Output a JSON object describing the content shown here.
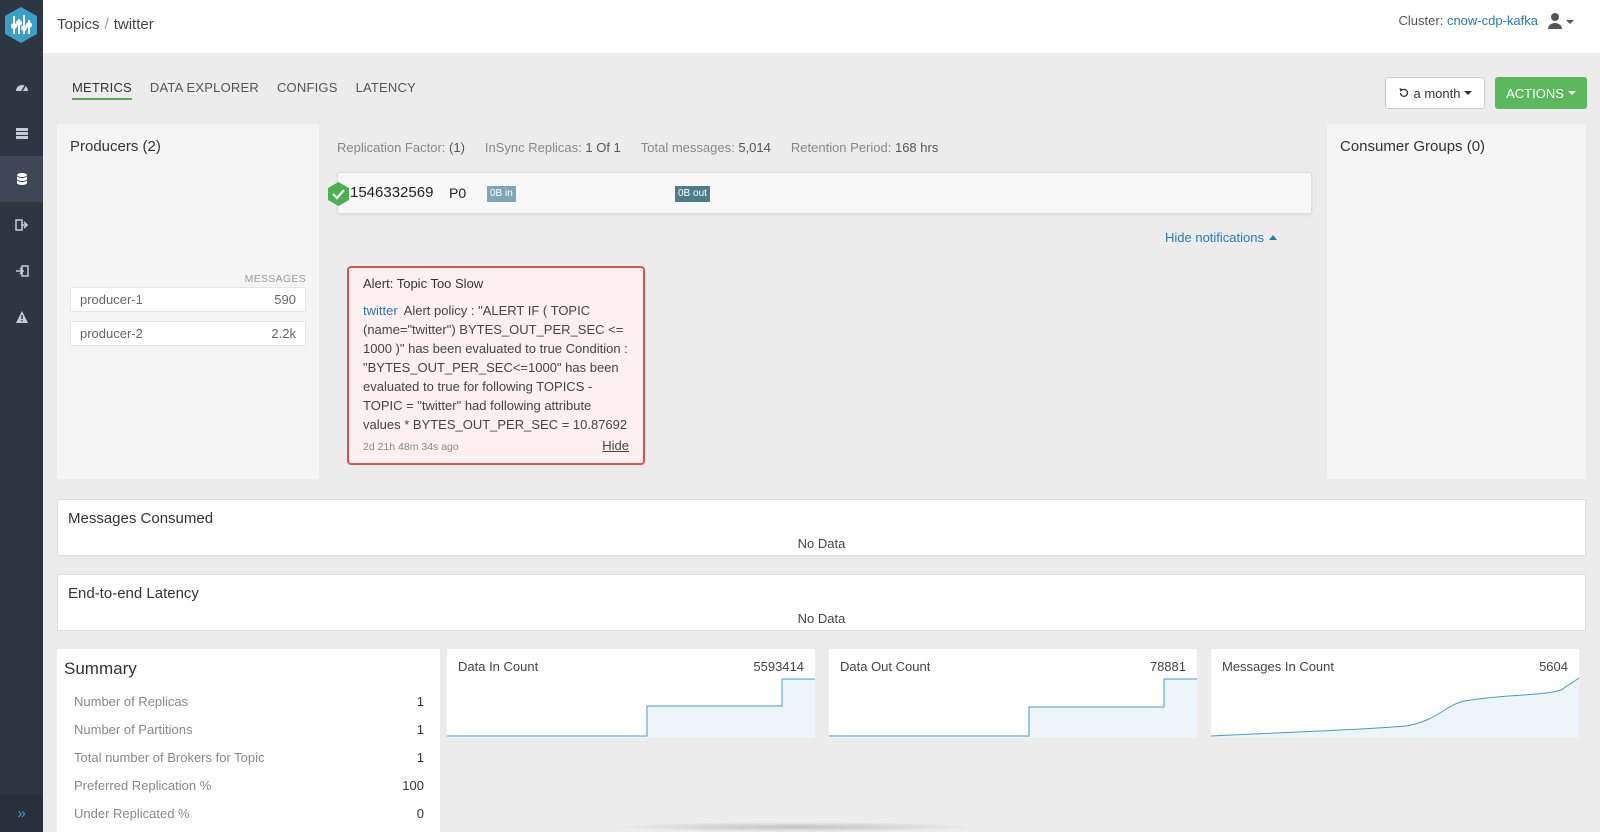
{
  "header": {
    "breadcrumb_root": "Topics",
    "breadcrumb_current": "twitter",
    "cluster_label": "Cluster:",
    "cluster_name": "cnow-cdp-kafka"
  },
  "tabs": [
    {
      "label": "METRICS",
      "active": true
    },
    {
      "label": "DATA EXPLORER",
      "active": false
    },
    {
      "label": "CONFIGS",
      "active": false
    },
    {
      "label": "LATENCY",
      "active": false
    }
  ],
  "toolbar": {
    "period_label": "a month",
    "actions_label": "ACTIONS"
  },
  "producers": {
    "title": "Producers (2)",
    "messages_header": "MESSAGES",
    "items": [
      {
        "name": "producer-1",
        "count": "590"
      },
      {
        "name": "producer-2",
        "count": "2.2k"
      }
    ]
  },
  "stats": {
    "replication_label": "Replication Factor:",
    "replication_value": "(1)",
    "insync_label": "InSync Replicas:",
    "insync_value": "1 Of 1",
    "total_label": "Total messages:",
    "total_value": "5,014",
    "retention_label": "Retention Period:",
    "retention_value": "168 hrs"
  },
  "partition": {
    "broker_id": "1546332569",
    "partition_id": "P0",
    "bytes_in": "0B in",
    "bytes_out": "0B out"
  },
  "notifications": {
    "toggle_label": "Hide notifications",
    "alert": {
      "title": "Alert: Topic Too Slow",
      "topic": "twitter",
      "message": "Alert policy : \"ALERT IF ( TOPIC (name=\"twitter\") BYTES_OUT_PER_SEC <= 1000 )\" has been evaluated to true Condition : \"BYTES_OUT_PER_SEC<=1000\" has been evaluated to true for following TOPICS - TOPIC = \"twitter\" had following attribute values * BYTES_OUT_PER_SEC = 10.87692",
      "time": "2d 21h 48m 34s ago",
      "hide_label": "Hide"
    }
  },
  "consumer_groups": {
    "title": "Consumer Groups (0)"
  },
  "messages_consumed": {
    "title": "Messages Consumed",
    "empty": "No Data"
  },
  "latency": {
    "title": "End-to-end Latency",
    "empty": "No Data"
  },
  "summary": {
    "title": "Summary",
    "rows": [
      {
        "label": "Number of Replicas",
        "value": "1"
      },
      {
        "label": "Number of Partitions",
        "value": "1"
      },
      {
        "label": "Total number of Brokers for Topic",
        "value": "1"
      },
      {
        "label": "Preferred Replication %",
        "value": "100"
      },
      {
        "label": "Under Replicated %",
        "value": "0"
      }
    ]
  },
  "metrics": [
    {
      "label": "Data In Count",
      "value": "5593414"
    },
    {
      "label": "Data Out Count",
      "value": "78881"
    },
    {
      "label": "Messages In Count",
      "value": "5604"
    }
  ],
  "colors": {
    "sidebar": "#2e3642",
    "accent_green": "#5cb85c",
    "link_blue": "#2a7ab3",
    "alert_red": "#d9534f",
    "chart_line": "#4a9cc0",
    "chart_fill": "#eef5f8"
  },
  "icons": {
    "sidebar": [
      "dashboard-icon",
      "brokers-icon",
      "topics-icon",
      "producers-icon",
      "consumers-icon",
      "alerts-icon"
    ],
    "expand": "double-chevron-right-icon"
  }
}
